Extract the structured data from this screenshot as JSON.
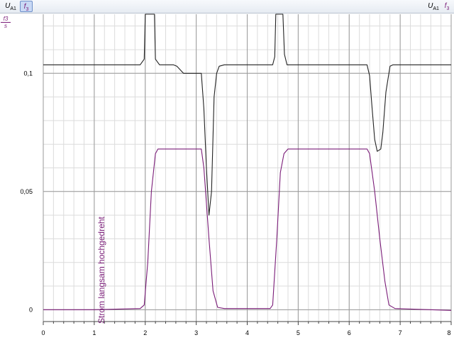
{
  "toolbar": {
    "left_ua1": {
      "main": "U",
      "sub": "A1"
    },
    "left_f3": {
      "main": "f",
      "sub": "3"
    },
    "right_ua1": {
      "main": "U",
      "sub": "A1"
    },
    "right_f3": {
      "main": "f",
      "sub": "3"
    }
  },
  "y_unit": {
    "numerator": "f3",
    "denominator": "s"
  },
  "chart_data": {
    "type": "line",
    "title": "",
    "xlabel": "",
    "ylabel": "",
    "xlim": [
      0,
      8
    ],
    "ylim": [
      -0.005,
      0.125
    ],
    "x_ticks": [
      0,
      1,
      2,
      3,
      4,
      5,
      6,
      7,
      8
    ],
    "x_tick_labels": [
      "0",
      "1",
      "2",
      "3",
      "4",
      "5",
      "6",
      "7",
      "8"
    ],
    "y_ticks": [
      0,
      0.05,
      0.1
    ],
    "y_tick_labels": [
      "0",
      "0,05",
      "0,1"
    ],
    "grid": true,
    "annotation": "Strom langsam hochgedreht",
    "series": [
      {
        "color": "#222222",
        "points": [
          [
            0,
            0.1036
          ],
          [
            1.9,
            0.1036
          ],
          [
            1.98,
            0.106
          ],
          [
            2.0,
            0.125
          ],
          [
            2.18,
            0.125
          ],
          [
            2.2,
            0.106
          ],
          [
            2.28,
            0.1036
          ],
          [
            2.55,
            0.1036
          ],
          [
            2.62,
            0.103
          ],
          [
            2.75,
            0.1
          ],
          [
            3.1,
            0.1
          ],
          [
            3.15,
            0.085
          ],
          [
            3.2,
            0.06
          ],
          [
            3.25,
            0.04
          ],
          [
            3.3,
            0.05
          ],
          [
            3.35,
            0.09
          ],
          [
            3.4,
            0.1
          ],
          [
            3.45,
            0.103
          ],
          [
            3.55,
            0.1036
          ],
          [
            4.5,
            0.1036
          ],
          [
            4.54,
            0.107
          ],
          [
            4.56,
            0.125
          ],
          [
            4.7,
            0.125
          ],
          [
            4.73,
            0.108
          ],
          [
            4.78,
            0.1036
          ],
          [
            6.35,
            0.1036
          ],
          [
            6.4,
            0.099
          ],
          [
            6.45,
            0.085
          ],
          [
            6.5,
            0.072
          ],
          [
            6.55,
            0.067
          ],
          [
            6.62,
            0.068
          ],
          [
            6.66,
            0.075
          ],
          [
            6.72,
            0.092
          ],
          [
            6.8,
            0.103
          ],
          [
            6.86,
            0.1036
          ],
          [
            8,
            0.1036
          ]
        ]
      },
      {
        "color": "#7a1c78",
        "points": [
          [
            0,
            0
          ],
          [
            1.0,
            0
          ],
          [
            1.9,
            0.0005
          ],
          [
            1.98,
            0.002
          ],
          [
            2.05,
            0.02
          ],
          [
            2.12,
            0.05
          ],
          [
            2.2,
            0.066
          ],
          [
            2.25,
            0.068
          ],
          [
            2.5,
            0.068
          ],
          [
            3.1,
            0.068
          ],
          [
            3.15,
            0.06
          ],
          [
            3.25,
            0.03
          ],
          [
            3.33,
            0.008
          ],
          [
            3.42,
            0.001
          ],
          [
            3.55,
            0.0005
          ],
          [
            4.45,
            0.0005
          ],
          [
            4.5,
            0.002
          ],
          [
            4.58,
            0.03
          ],
          [
            4.65,
            0.058
          ],
          [
            4.72,
            0.066
          ],
          [
            4.8,
            0.068
          ],
          [
            5.0,
            0.068
          ],
          [
            6.35,
            0.068
          ],
          [
            6.4,
            0.066
          ],
          [
            6.5,
            0.05
          ],
          [
            6.6,
            0.03
          ],
          [
            6.7,
            0.012
          ],
          [
            6.78,
            0.002
          ],
          [
            6.9,
            0.0005
          ],
          [
            8,
            -0.0003
          ]
        ]
      }
    ]
  }
}
